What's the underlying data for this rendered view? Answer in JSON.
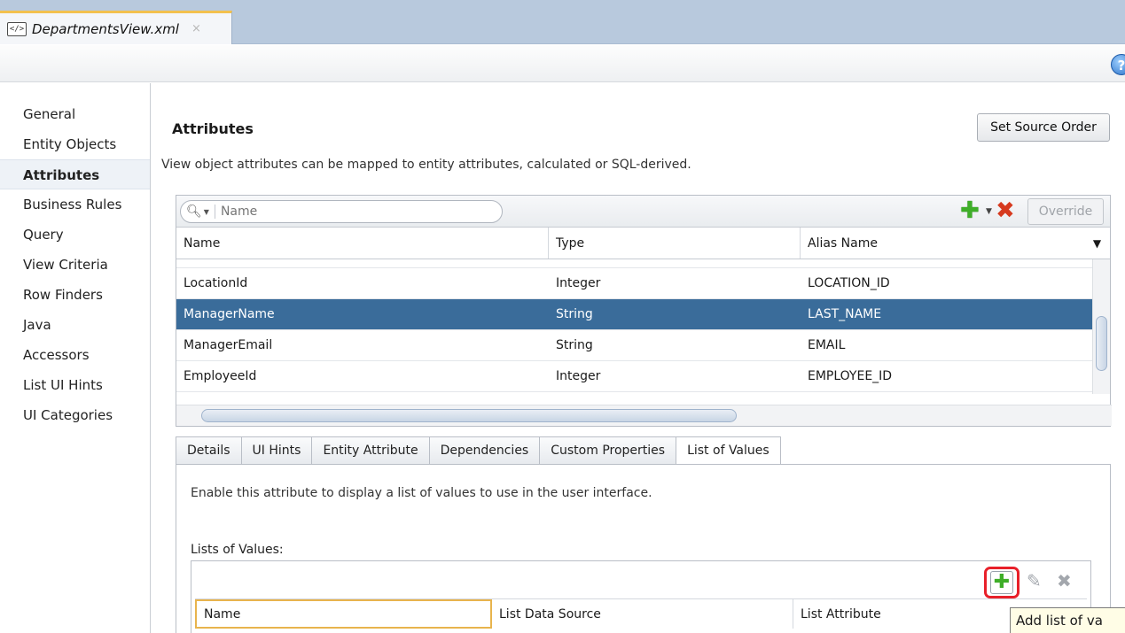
{
  "editor_tab": {
    "title": "DepartmentsView.xml",
    "close": "×",
    "icon": "xml-file-icon"
  },
  "toolbar": {
    "help": "?"
  },
  "nav": {
    "items": [
      {
        "label": "General"
      },
      {
        "label": "Entity Objects"
      },
      {
        "label": "Attributes",
        "active": true
      },
      {
        "label": "Business Rules"
      },
      {
        "label": "Query"
      },
      {
        "label": "View Criteria"
      },
      {
        "label": "Row Finders"
      },
      {
        "label": "Java"
      },
      {
        "label": "Accessors"
      },
      {
        "label": "List UI Hints"
      },
      {
        "label": "UI Categories"
      }
    ]
  },
  "attributes": {
    "title": "Attributes",
    "set_source_order_label": "Set Source Order",
    "description": "View object attributes can be mapped to entity attributes, calculated or SQL-derived.",
    "search_placeholder": "Name",
    "override_label": "Override",
    "columns": [
      "Name",
      "Type",
      "Alias Name"
    ],
    "rows": [
      {
        "name": "LocationId",
        "type": "Integer",
        "alias": "LOCATION_ID"
      },
      {
        "name": "ManagerName",
        "type": "String",
        "alias": "LAST_NAME",
        "selected": true
      },
      {
        "name": "ManagerEmail",
        "type": "String",
        "alias": "EMAIL"
      },
      {
        "name": "EmployeeId",
        "type": "Integer",
        "alias": "EMPLOYEE_ID"
      }
    ]
  },
  "detail_tabs": [
    "Details",
    "UI Hints",
    "Entity Attribute",
    "Dependencies",
    "Custom Properties",
    "List of Values"
  ],
  "active_detail_tab": "List of Values",
  "lov_panel": {
    "description": "Enable this attribute to display a list of values to use in the user interface.",
    "label": "Lists of Values:",
    "columns": [
      "Name",
      "List Data Source",
      "List Attribute"
    ],
    "tooltip": "Add list of va"
  },
  "colors": {
    "selection": "#3a6c9a",
    "highlight": "#e8202a",
    "add_green": "#3fae29",
    "delete_red": "#d63a1f"
  }
}
